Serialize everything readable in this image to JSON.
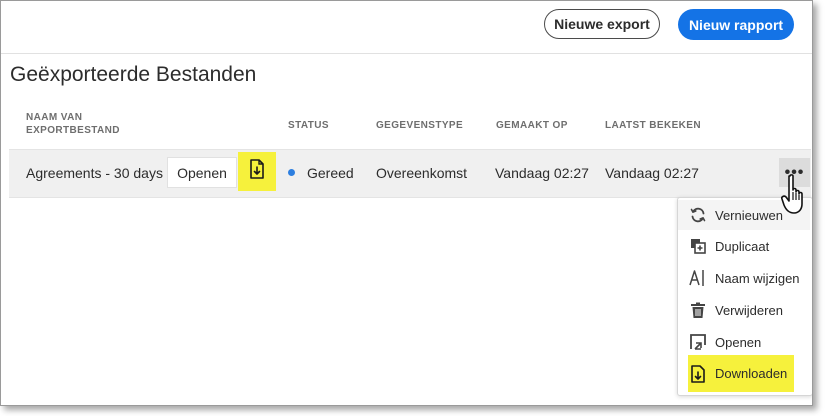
{
  "header": {
    "new_export_label": "Nieuwe export",
    "new_report_label": "Nieuw rapport"
  },
  "page": {
    "title": "Geëxporteerde Bestanden"
  },
  "table": {
    "columns": {
      "name": [
        "NAAM VAN",
        "EXPORTBESTAND"
      ],
      "status": "STATUS",
      "data_type": "GEGEVENSTYPE",
      "created": "GEMAAKT OP",
      "last_viewed": "LAATST BEKEKEN"
    },
    "rows": [
      {
        "name": "Agreements - 30 days",
        "open_label": "Openen",
        "status": "Gereed",
        "data_type": "Overeenkomst",
        "created": "Vandaag 02:27",
        "last_viewed": "Vandaag 02:27"
      }
    ]
  },
  "more_button": {
    "label": "•••"
  },
  "context_menu": {
    "items": [
      {
        "label": "Vernieuwen",
        "icon": "refresh-icon"
      },
      {
        "label": "Duplicaat",
        "icon": "duplicate-icon"
      },
      {
        "label": "Naam wijzigen",
        "icon": "rename-icon"
      },
      {
        "label": "Verwijderen",
        "icon": "trash-icon"
      },
      {
        "label": "Openen",
        "icon": "open-icon"
      },
      {
        "label": "Downloaden",
        "icon": "download-icon"
      }
    ]
  },
  "colors": {
    "primary": "#1473e6",
    "highlight": "#f6f13c",
    "status_dot": "#2d7fe0",
    "row_bg": "#f0f0f0"
  }
}
